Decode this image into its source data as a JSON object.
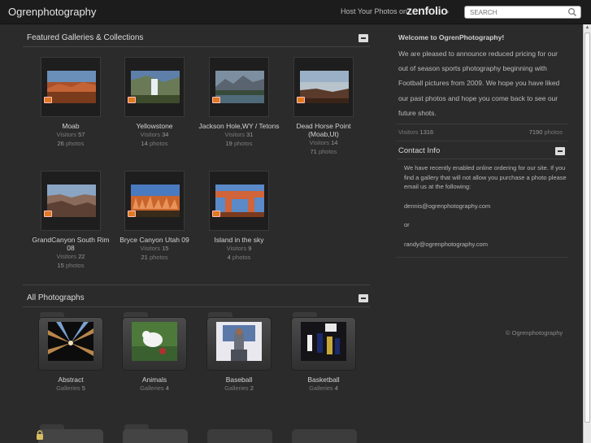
{
  "header": {
    "site_title": "Ogrenphotography",
    "hosted_text": "Host Your Photos on",
    "brand": "zenfolio",
    "brand_arrow": "»",
    "search_placeholder": "SEARCH"
  },
  "featured": {
    "heading": "Featured Galleries & Collections",
    "galleries": [
      {
        "title": "Moab",
        "visitors_label": "Visitors",
        "visitors": "57",
        "photos": "26",
        "photos_label": "photos"
      },
      {
        "title": "Yellowstone",
        "visitors_label": "Visitors",
        "visitors": "34",
        "photos": "14",
        "photos_label": "photos"
      },
      {
        "title": "Jackson Hole,WY / Tetons",
        "visitors_label": "Visitors",
        "visitors": "31",
        "photos": "19",
        "photos_label": "photos"
      },
      {
        "title": "Dead Horse Point (Moab,Ut)",
        "visitors_label": "Visitors",
        "visitors": "14",
        "photos": "71",
        "photos_label": "photos"
      },
      {
        "title": "GrandCanyon South Rim 08",
        "visitors_label": "Visitors",
        "visitors": "22",
        "photos": "15",
        "photos_label": "photos"
      },
      {
        "title": "Bryce Canyon Utah 09",
        "visitors_label": "Visitors",
        "visitors": "15",
        "photos": "21",
        "photos_label": "photos"
      },
      {
        "title": "Island in the sky",
        "visitors_label": "Visitors",
        "visitors": "9",
        "photos": "4",
        "photos_label": "photos"
      }
    ]
  },
  "all_photos": {
    "heading": "All Photographs",
    "groups": [
      {
        "title": "Abstract",
        "galleries_label": "Galleries",
        "galleries": "5"
      },
      {
        "title": "Animals",
        "galleries_label": "Galleries",
        "galleries": "4"
      },
      {
        "title": "Baseball",
        "galleries_label": "Galleries",
        "galleries": "2"
      },
      {
        "title": "Basketball",
        "galleries_label": "Galleries",
        "galleries": "4"
      }
    ]
  },
  "welcome": {
    "title": "Welcome to OgrenPhotography!",
    "body": "We are pleased to announce reduced pricing for our out of season sports photography beginning with Football pictures from 2009. We hope you have liked our past photos and hope you come back to see our future shots.",
    "visitors_label": "Visitors",
    "visitors": "1316",
    "photos": "7190",
    "photos_label": "photos"
  },
  "contact": {
    "title": "Contact Info",
    "line1": "We have recently enabled online ordering for our site. If you find a gallery that will not allow you purchase a photo please email us at the following:",
    "email1": "dennis@ogrenphotography.com",
    "or": "or",
    "email2": "randy@ogrenphotography.com"
  },
  "footer": {
    "copyright": "© Ogrenphotography"
  },
  "colors": {
    "background": "#2b2b2b",
    "topbar": "#1c1c1c",
    "badge": "#e07a1f"
  }
}
